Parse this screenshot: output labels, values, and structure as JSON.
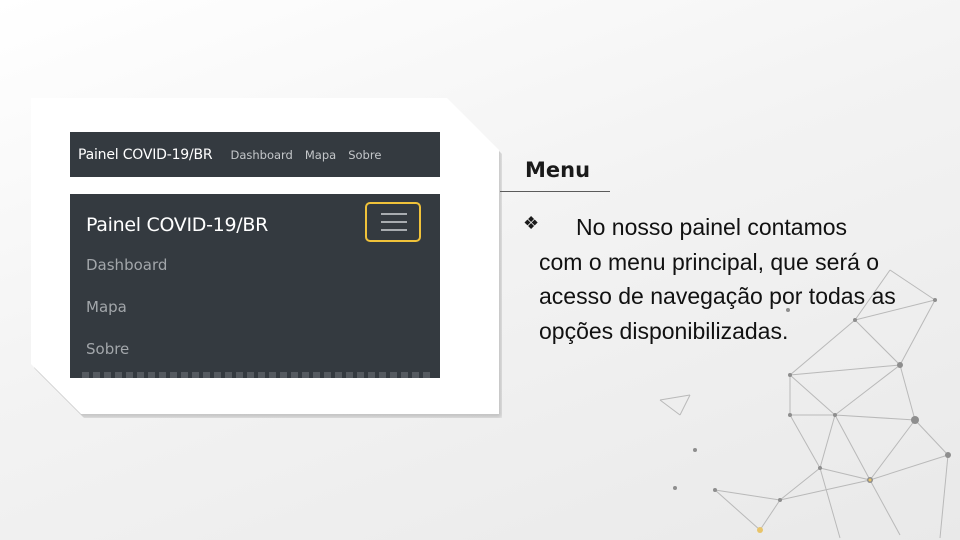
{
  "screenshot_small_navbar": {
    "brand": "Painel COVID-19/BR",
    "links": [
      "Dashboard",
      "Mapa",
      "Sobre"
    ]
  },
  "screenshot_expanded_navbar": {
    "brand": "Painel COVID-19/BR",
    "toggler_icon": "hamburger-menu-icon",
    "items": [
      "Dashboard",
      "Mapa",
      "Sobre"
    ]
  },
  "slide": {
    "title": "Menu",
    "bullet_icon": "four-diamond-bullet-icon",
    "bullet_glyph": "❖",
    "paragraph_first_line": "No nosso painel contamos",
    "paragraph_rest": "com o menu principal, que será o acesso de navegação por todas as opções disponibilizadas."
  },
  "colors": {
    "navbar_bg": "#343a40",
    "toggler_border": "#f0c23a",
    "background": "#f0f0f0"
  }
}
